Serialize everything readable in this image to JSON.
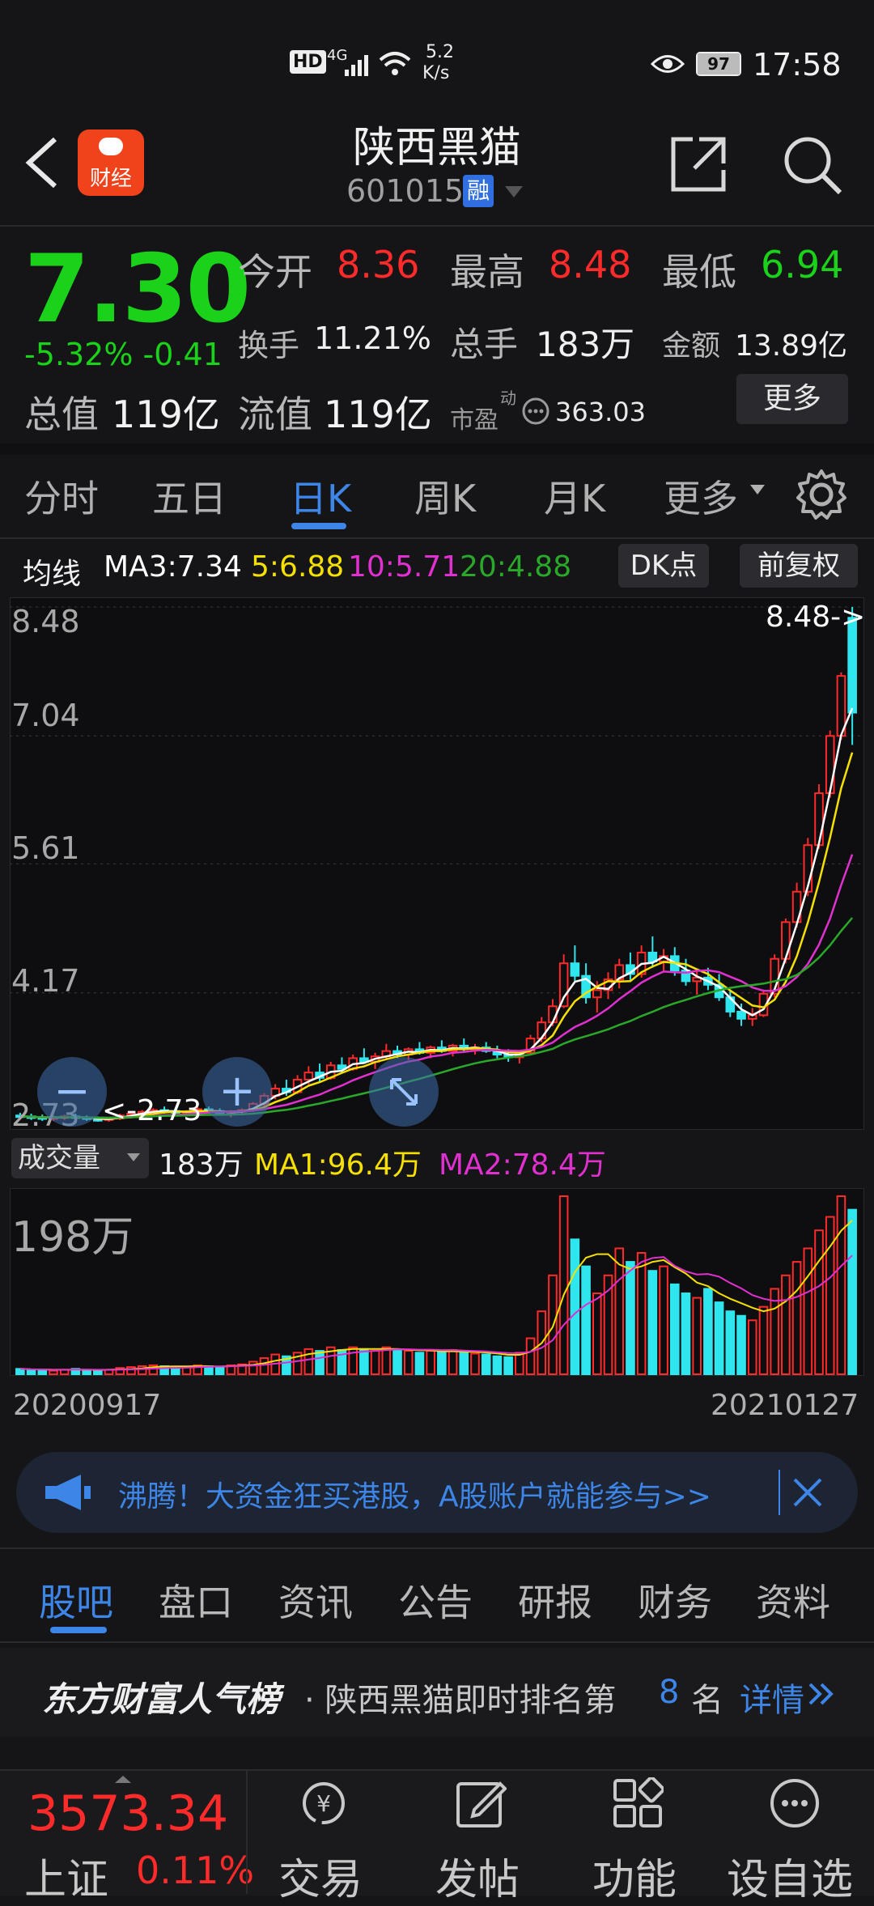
{
  "status_bar": {
    "hd": "HD",
    "net": "4G",
    "speed_value": "5.2",
    "speed_unit": "K/s",
    "battery": "97",
    "time": "17:58"
  },
  "header": {
    "app_badge": "财经",
    "title": "陕西黑猫",
    "code": "601015",
    "margin_badge": "融"
  },
  "quote": {
    "price": "7.30",
    "change": "-5.32% -0.41",
    "open_label": "今开",
    "open_value": "8.36",
    "high_label": "最高",
    "high_value": "8.48",
    "low_label": "最低",
    "low_value": "6.94",
    "turnover_label": "换手",
    "turnover_value": "11.21%",
    "volume_label": "总手",
    "volume_value": "183万",
    "amount_label": "金额",
    "amount_value": "13.89亿",
    "mktcap_label": "总值",
    "mktcap_value": "119亿",
    "float_label": "流值",
    "float_value": "119亿",
    "pe_label": "市盈",
    "pe_sup": "动",
    "pe_value": "363.03",
    "more_label": "更多"
  },
  "tabs": [
    "分时",
    "五日",
    "日K",
    "周K",
    "月K",
    "更多"
  ],
  "active_tab": "日K",
  "ma_legend": {
    "label": "均线",
    "ma3": "MA3:7.34",
    "ma5": "5:6.88",
    "ma10": "10:5.71",
    "ma20": "20:4.88",
    "dk_label": "DK点",
    "adjust_label": "前复权"
  },
  "chart_axis": {
    "y1": "8.48",
    "y2": "7.04",
    "y3": "5.61",
    "y4": "4.17",
    "y5": "2.73",
    "high_marker": "8.48->",
    "low_marker": "<-2.73"
  },
  "volume": {
    "label": "成交量",
    "value": "183万",
    "ma1": "MA1:96.4万",
    "ma2": "MA2:78.4万",
    "max_label": "198万",
    "start_date": "20200917",
    "end_date": "20210127"
  },
  "banner": {
    "text": "沸腾！大资金狂买港股，A股账户就能参与>>"
  },
  "lower_tabs": [
    "股吧",
    "盘口",
    "资讯",
    "公告",
    "研报",
    "财务",
    "资料"
  ],
  "ranking": {
    "brand": "东方财富人气榜",
    "text": "· 陕西黑猫即时排名第",
    "rank": "8",
    "unit": "名",
    "detail": "详情"
  },
  "bottom_nav": {
    "index_value": "3573.34",
    "index_name": "上证",
    "index_change": "0.11%",
    "items": [
      "交易",
      "发帖",
      "功能",
      "设自选"
    ]
  },
  "colors": {
    "up": "#ff2a2a",
    "down": "#1ad21a",
    "accent": "#3d86e8",
    "ma3": "#ffffff",
    "ma5": "#f5e000",
    "ma10": "#e030d0",
    "ma20": "#2aa82a",
    "vol_down": "#2fe6ee"
  },
  "chart_data": {
    "type": "candlestick",
    "date_range": [
      "20200917",
      "20210127"
    ],
    "ylim": [
      2.73,
      8.48
    ],
    "ohlc": [
      [
        2.8,
        2.83,
        2.76,
        2.79
      ],
      [
        2.79,
        2.82,
        2.75,
        2.78
      ],
      [
        2.78,
        2.81,
        2.74,
        2.77
      ],
      [
        2.77,
        2.8,
        2.74,
        2.78
      ],
      [
        2.78,
        2.81,
        2.75,
        2.79
      ],
      [
        2.79,
        2.82,
        2.76,
        2.78
      ],
      [
        2.78,
        2.8,
        2.74,
        2.76
      ],
      [
        2.76,
        2.79,
        2.73,
        2.75
      ],
      [
        2.75,
        2.78,
        2.73,
        2.77
      ],
      [
        2.77,
        2.82,
        2.75,
        2.8
      ],
      [
        2.8,
        2.84,
        2.77,
        2.82
      ],
      [
        2.82,
        2.86,
        2.79,
        2.84
      ],
      [
        2.84,
        2.88,
        2.81,
        2.86
      ],
      [
        2.86,
        2.9,
        2.82,
        2.85
      ],
      [
        2.85,
        2.88,
        2.8,
        2.83
      ],
      [
        2.83,
        2.86,
        2.79,
        2.84
      ],
      [
        2.84,
        2.89,
        2.81,
        2.87
      ],
      [
        2.87,
        2.9,
        2.82,
        2.85
      ],
      [
        2.85,
        2.88,
        2.8,
        2.82
      ],
      [
        2.82,
        2.86,
        2.78,
        2.84
      ],
      [
        2.84,
        2.88,
        2.8,
        2.86
      ],
      [
        2.86,
        2.95,
        2.84,
        2.93
      ],
      [
        2.93,
        3.05,
        2.9,
        3.02
      ],
      [
        3.02,
        3.15,
        2.98,
        3.1
      ],
      [
        3.1,
        3.2,
        3.02,
        3.06
      ],
      [
        3.06,
        3.25,
        3.04,
        3.2
      ],
      [
        3.2,
        3.35,
        3.15,
        3.28
      ],
      [
        3.28,
        3.38,
        3.18,
        3.22
      ],
      [
        3.22,
        3.4,
        3.2,
        3.36
      ],
      [
        3.36,
        3.45,
        3.28,
        3.32
      ],
      [
        3.32,
        3.48,
        3.3,
        3.44
      ],
      [
        3.44,
        3.55,
        3.38,
        3.4
      ],
      [
        3.4,
        3.5,
        3.32,
        3.46
      ],
      [
        3.46,
        3.6,
        3.42,
        3.52
      ],
      [
        3.52,
        3.58,
        3.44,
        3.48
      ],
      [
        3.48,
        3.56,
        3.42,
        3.54
      ],
      [
        3.54,
        3.62,
        3.48,
        3.5
      ],
      [
        3.5,
        3.58,
        3.44,
        3.56
      ],
      [
        3.56,
        3.64,
        3.5,
        3.52
      ],
      [
        3.52,
        3.6,
        3.46,
        3.58
      ],
      [
        3.58,
        3.66,
        3.52,
        3.54
      ],
      [
        3.54,
        3.6,
        3.48,
        3.56
      ],
      [
        3.56,
        3.62,
        3.5,
        3.52
      ],
      [
        3.52,
        3.58,
        3.44,
        3.48
      ],
      [
        3.48,
        3.54,
        3.4,
        3.45
      ],
      [
        3.45,
        3.52,
        3.38,
        3.5
      ],
      [
        3.5,
        3.7,
        3.48,
        3.66
      ],
      [
        3.66,
        3.9,
        3.62,
        3.84
      ],
      [
        3.84,
        4.1,
        3.8,
        4.02
      ],
      [
        4.02,
        4.6,
        4.0,
        4.5
      ],
      [
        4.5,
        4.7,
        4.3,
        4.36
      ],
      [
        4.36,
        4.5,
        4.05,
        4.12
      ],
      [
        4.12,
        4.3,
        3.95,
        4.2
      ],
      [
        4.2,
        4.4,
        4.1,
        4.32
      ],
      [
        4.32,
        4.55,
        4.22,
        4.48
      ],
      [
        4.48,
        4.62,
        4.3,
        4.38
      ],
      [
        4.38,
        4.7,
        4.34,
        4.62
      ],
      [
        4.62,
        4.8,
        4.45,
        4.52
      ],
      [
        4.52,
        4.66,
        4.4,
        4.58
      ],
      [
        4.58,
        4.68,
        4.36,
        4.42
      ],
      [
        4.42,
        4.55,
        4.25,
        4.3
      ],
      [
        4.3,
        4.42,
        4.15,
        4.34
      ],
      [
        4.34,
        4.45,
        4.2,
        4.26
      ],
      [
        4.26,
        4.38,
        4.08,
        4.12
      ],
      [
        4.12,
        4.2,
        3.9,
        3.96
      ],
      [
        3.96,
        4.05,
        3.8,
        3.88
      ],
      [
        3.88,
        4.0,
        3.8,
        3.92
      ],
      [
        3.92,
        4.2,
        3.9,
        4.16
      ],
      [
        4.16,
        4.6,
        4.12,
        4.55
      ],
      [
        4.55,
        5.0,
        4.5,
        4.96
      ],
      [
        4.96,
        5.4,
        4.9,
        5.3
      ],
      [
        5.3,
        5.9,
        5.25,
        5.82
      ],
      [
        5.82,
        6.5,
        5.78,
        6.4
      ],
      [
        6.4,
        7.1,
        6.35,
        7.04
      ],
      [
        7.04,
        7.75,
        7.0,
        7.71
      ],
      [
        8.36,
        8.48,
        6.94,
        7.3
      ]
    ],
    "volume": [
      6,
      5,
      5,
      4,
      5,
      6,
      5,
      4,
      5,
      7,
      8,
      9,
      10,
      9,
      8,
      8,
      10,
      9,
      8,
      10,
      11,
      14,
      18,
      22,
      20,
      24,
      28,
      26,
      30,
      27,
      30,
      28,
      26,
      30,
      27,
      26,
      24,
      26,
      25,
      27,
      24,
      23,
      22,
      20,
      19,
      24,
      40,
      70,
      110,
      198,
      150,
      120,
      90,
      110,
      140,
      125,
      135,
      115,
      120,
      100,
      90,
      85,
      95,
      80,
      70,
      65,
      60,
      75,
      95,
      110,
      125,
      140,
      160,
      175,
      198,
      183
    ],
    "ma_values": {
      "MA3": 7.34,
      "MA5": 6.88,
      "MA10": 5.71,
      "MA20": 4.88
    },
    "volume_ma": {
      "MA1": 96.4,
      "MA2": 78.4
    },
    "volume_unit": "万"
  }
}
